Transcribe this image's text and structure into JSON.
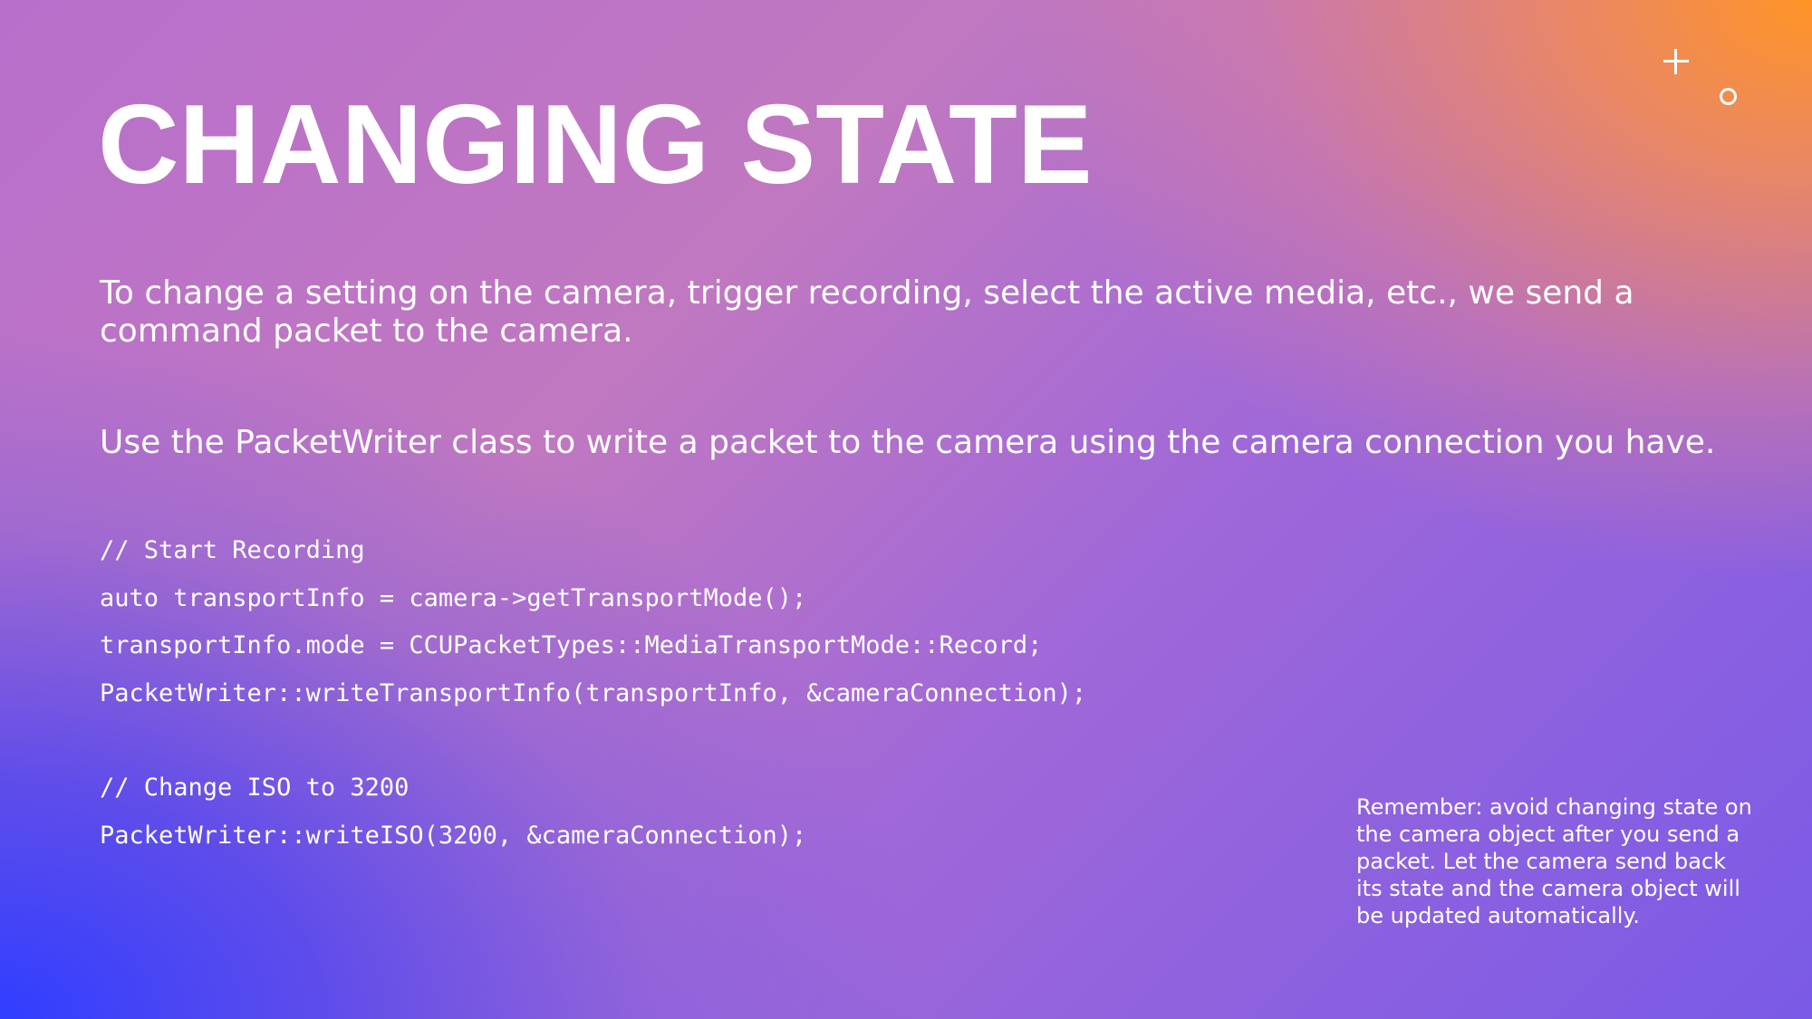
{
  "slide": {
    "title": "CHANGING STATE",
    "paragraph1": "To change a setting on the camera, trigger recording, select the active media, etc., we send a command packet to the camera.",
    "paragraph2": "Use the PacketWriter class to write a packet to the camera using the camera connection you have.",
    "code_block_1": [
      "// Start Recording",
      "auto transportInfo = camera->getTransportMode();",
      "transportInfo.mode = CCUPacketTypes::MediaTransportMode::Record;",
      "PacketWriter::writeTransportInfo(transportInfo, &cameraConnection);"
    ],
    "code_block_2": [
      "// Change ISO to 3200",
      "PacketWriter::writeISO(3200, &cameraConnection);"
    ],
    "note": "Remember: avoid changing state on the camera object after you send a packet. Let the camera send back its state and the camera object will be updated automatically.",
    "decorations": {
      "plus_icon": "plus-icon",
      "ring_icon": "circle-outline-icon"
    },
    "colors": {
      "gradient_top_right": "#ff9426",
      "gradient_bottom_left": "#303eff",
      "gradient_mid": "#b86fcc",
      "text": "#ffffff"
    }
  }
}
